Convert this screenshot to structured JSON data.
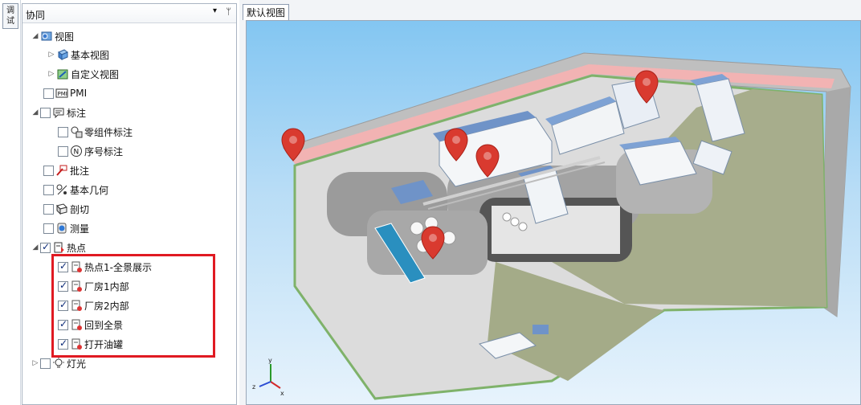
{
  "side_tab": {
    "label": "调\n试"
  },
  "panel": {
    "title": "协同",
    "menu_glyph": "▾",
    "pin_glyph": "ᛘ"
  },
  "tree": {
    "view": "视图",
    "basic_view": "基本视图",
    "custom_view": "自定义视图",
    "pmi": "PMI",
    "annotation": "标注",
    "part_annotation": "零组件标注",
    "serial_annotation": "序号标注",
    "markup": "批注",
    "basic_geometry": "基本几何",
    "section": "剖切",
    "measure": "测量",
    "hotspot": "热点",
    "hotspot_items": [
      "热点1-全景展示",
      "厂房1内部",
      "厂房2内部",
      "回到全景",
      "打开油罐"
    ],
    "light": "灯光"
  },
  "view_tab": {
    "label": "默认视图"
  },
  "axis": {
    "y": "y",
    "x": "x",
    "z": "z"
  },
  "colors": {
    "highlight": "#e01a22",
    "accent": "#0b2a78",
    "marker": "#d93a2f"
  }
}
